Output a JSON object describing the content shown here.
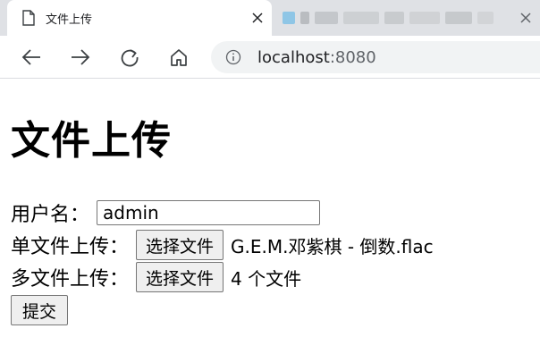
{
  "browser": {
    "active_tab": {
      "title": "文件上传",
      "icon": "page-icon",
      "close_icon": "close-icon"
    },
    "inactive_tab": {
      "close_icon": "close-icon"
    },
    "nav": {
      "back_icon": "arrow-left-icon",
      "forward_icon": "arrow-right-icon",
      "reload_icon": "reload-icon",
      "home_icon": "home-icon"
    },
    "address": {
      "info_icon": "info-icon",
      "host": "localhost",
      "port": ":8080"
    }
  },
  "page": {
    "title": "文件上传",
    "form": {
      "username": {
        "label": "用户名：",
        "value": "admin"
      },
      "single_file": {
        "label": "单文件上传：",
        "button": "选择文件",
        "status": "G.E.M.邓紫棋 - 倒数.flac"
      },
      "multi_file": {
        "label": "多文件上传：",
        "button": "选择文件",
        "status": "4 个文件"
      },
      "submit_label": "提交"
    }
  },
  "colors": {
    "tabbar_bg": "#dfe1e5",
    "omnibox_bg": "#f1f3f4",
    "button_bg": "#efefef",
    "icon": "#3c4043"
  }
}
